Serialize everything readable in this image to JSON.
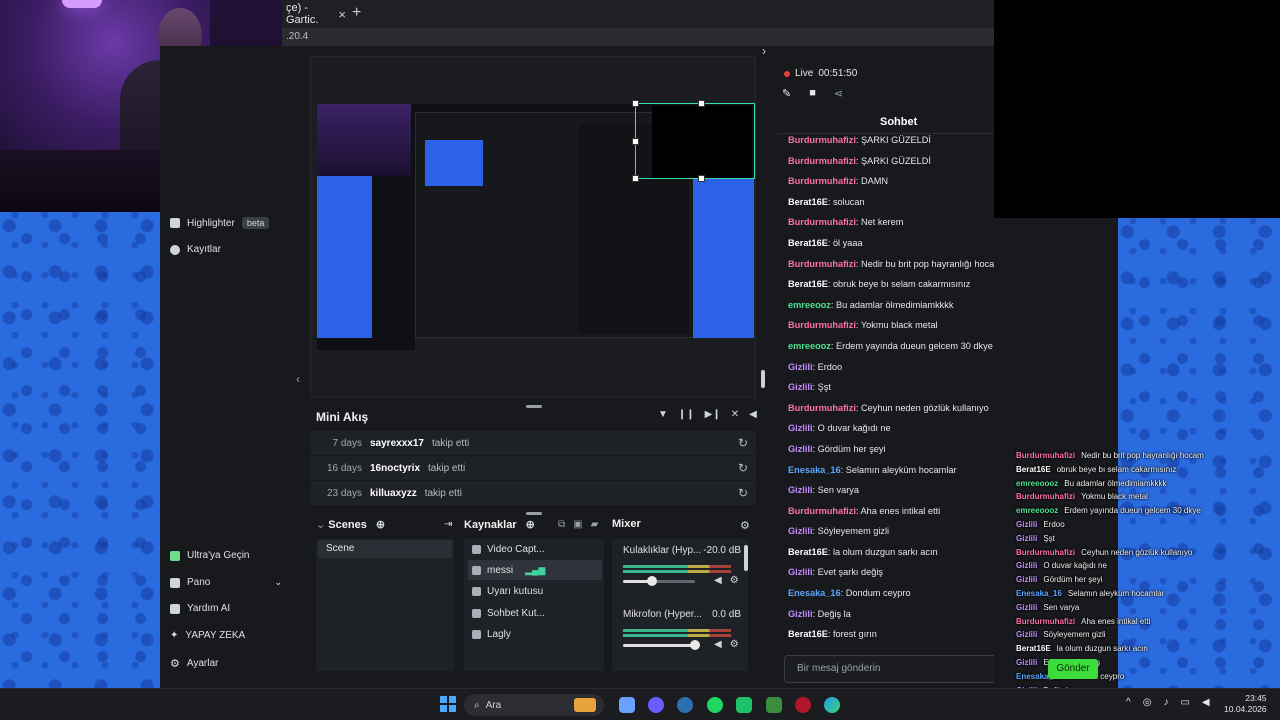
{
  "browser": {
    "tab_title": "çe) - Gartic.",
    "tab_close": "×",
    "new_tab": "+",
    "url_fragment": ".20.4"
  },
  "sidebar": {
    "items": [
      {
        "label": "Highlighter",
        "badge": "beta",
        "icon": "highlighter-icon"
      },
      {
        "label": "Kayıtlar",
        "icon": "play-icon"
      }
    ],
    "bottom": [
      {
        "label": "Ultra'ya Geçin",
        "icon": "ultra-icon"
      },
      {
        "label": "Pano",
        "icon": "dashboard-icon"
      },
      {
        "label": "Yardım AI",
        "icon": "ai-help-icon"
      },
      {
        "label": "YAPAY ZEKA",
        "icon": "sparkle-icon"
      },
      {
        "label": "Ayarlar",
        "icon": "gear-icon"
      }
    ]
  },
  "feed": {
    "title": "Mini Akış",
    "rows": [
      {
        "days": "7 days",
        "user": "sayrexxx17",
        "action": "takip etti"
      },
      {
        "days": "16 days",
        "user": "16noctyrix",
        "action": "takip etti"
      },
      {
        "days": "23 days",
        "user": "killuaxyzz",
        "action": "takip etti"
      }
    ]
  },
  "docks": {
    "scenes_title": "Scenes",
    "scenes": [
      "Scene"
    ],
    "sources_title": "Kaynaklar",
    "sources": [
      "Video Capt...",
      "messi",
      "Uyarı kutusu",
      "Sohbet Kut...",
      "Lagly"
    ],
    "mixer_title": "Mixer",
    "mixer": [
      {
        "name": "Kulaklıklar (Hyp...",
        "db": "-20.0 dB",
        "level": 0.4
      },
      {
        "name": "Mikrofon (Hyper...",
        "db": "0.0 dB",
        "level": 1.0
      }
    ]
  },
  "live": {
    "status": "Live",
    "timer": "00:51:50"
  },
  "chat": {
    "tab": "Sohbet",
    "placeholder": "Bir mesaj gönderin",
    "messages": [
      {
        "user": "Burdurmuhafizi",
        "text": ": ŞARKI GÜZELDİ",
        "color": "#ff6fa8"
      },
      {
        "user": "Burdurmuhafizi",
        "text": ": ŞARKI GÜZELDİ",
        "color": "#ff6fa8"
      },
      {
        "user": "Burdurmuhafizi",
        "text": ": DAMN",
        "color": "#ff6fa8"
      },
      {
        "user": "Berat16E",
        "text": ": solucan",
        "color": "#ffffff"
      },
      {
        "user": "Burdurmuhafizi",
        "text": ": Net kerem",
        "color": "#ff6fa8"
      },
      {
        "user": "Berat16E",
        "text": ": öl yaaa",
        "color": "#ffffff"
      },
      {
        "user": "Burdurmuhafizi",
        "text": ": Nedir bu brit pop hayranlığı hocam",
        "color": "#ff6fa8"
      },
      {
        "user": "Berat16E",
        "text": ": obruk beye bı selam cakarmısınız",
        "color": "#ffffff"
      },
      {
        "user": "emreeooz",
        "text": ": Bu adamlar ölmedimiamkkkk",
        "color": "#4ce28f"
      },
      {
        "user": "Burdurmuhafizi",
        "text": ": Yokmu black metal",
        "color": "#ff6fa8"
      },
      {
        "user": "emreeooz",
        "text": ": Erdem yayında dueun gelcem 30 dkye",
        "color": "#4ce28f"
      },
      {
        "user": "Gizlili",
        "text": ": Erdoo",
        "color": "#c58cff"
      },
      {
        "user": "Gizlili",
        "text": ": Şşt",
        "color": "#c58cff"
      },
      {
        "user": "Burdurmuhafizi",
        "text": ": Ceyhun neden gözlük kullanıyo",
        "color": "#ff6fa8"
      },
      {
        "user": "Gizlili",
        "text": ": O duvar kağıdı ne",
        "color": "#c58cff"
      },
      {
        "user": "Gizlili",
        "text": ": Gördüm her şeyi",
        "color": "#c58cff"
      },
      {
        "user": "Enesaka_16",
        "text": ": Selamın aleyküm hocamlar",
        "color": "#5aa7ff"
      },
      {
        "user": "Gizlili",
        "text": ": Sen varya",
        "color": "#c58cff"
      },
      {
        "user": "Burdurmuhafizi",
        "text": ": Aha enes intikal etti",
        "color": "#ff6fa8"
      },
      {
        "user": "Gizlili",
        "text": ": Söyleyemem gizli",
        "color": "#c58cff"
      },
      {
        "user": "Berat16E",
        "text": ": la olum duzgun sarkı acın",
        "color": "#ffffff"
      },
      {
        "user": "Gizlili",
        "text": ": Evet şarkı değiş",
        "color": "#c58cff"
      },
      {
        "user": "Enesaka_16",
        "text": ": Dondum ceypro",
        "color": "#5aa7ff"
      },
      {
        "user": "Gizlili",
        "text": ": Değiş la",
        "color": "#c58cff"
      },
      {
        "user": "Berat16E",
        "text": ": forest gırın",
        "color": "#ffffff"
      }
    ]
  },
  "overlay_chat": {
    "messages": [
      {
        "user": "Burdurmuhafizi",
        "text": "Nedir bu brit pop hayranlığı hocam",
        "color": "#ff6fa8"
      },
      {
        "user": "Berat16E",
        "text": "obruk beye bı selam cakarmısınız",
        "color": "#ffffff"
      },
      {
        "user": "emreeoooz",
        "text": "Bu adamlar ölmedimiamkkkk",
        "color": "#4ce28f"
      },
      {
        "user": "Burdurmuhafizi",
        "text": "Yokmu black metal",
        "color": "#ff6fa8"
      },
      {
        "user": "emreeoooz",
        "text": "Erdem yayında dueun gelcem 30 dkye",
        "color": "#4ce28f"
      },
      {
        "user": "Gizlili",
        "text": "Erdoo",
        "color": "#c58cff"
      },
      {
        "user": "Gizlili",
        "text": "Şşt",
        "color": "#c58cff"
      },
      {
        "user": "Burdurmuhafizi",
        "text": "Ceyhun neden gözlük kullanıyo",
        "color": "#ff6fa8"
      },
      {
        "user": "Gizlili",
        "text": "O duvar kağıdı ne",
        "color": "#c58cff"
      },
      {
        "user": "Gizlili",
        "text": "Gördüm her şeyi",
        "color": "#c58cff"
      },
      {
        "user": "Enesaka_16",
        "text": "Selamın aleyküm hocamlar",
        "color": "#5aa7ff"
      },
      {
        "user": "Gizlili",
        "text": "Sen varya",
        "color": "#c58cff"
      },
      {
        "user": "Burdurmuhafizi",
        "text": "Aha enes intikal etti",
        "color": "#ff6fa8"
      },
      {
        "user": "Gizlili",
        "text": "Söyleyemem gizli",
        "color": "#c58cff"
      },
      {
        "user": "Berat16E",
        "text": "la olum duzgun sarkı acın",
        "color": "#ffffff"
      },
      {
        "user": "Gizlili",
        "text": "Evet şarkı değiş",
        "color": "#c58cff"
      },
      {
        "user": "Enesaka_16",
        "text": "Dondum ceypro",
        "color": "#5aa7ff"
      },
      {
        "user": "Gizlili",
        "text": "Değiş la",
        "color": "#c58cff"
      },
      {
        "user": "Berat16E",
        "text": "forest gırın",
        "color": "#ffffff"
      }
    ],
    "send_button": "Gönder"
  },
  "taskbar": {
    "search_placeholder": "Ara",
    "time": "23:45",
    "date": "10.04.2026"
  }
}
